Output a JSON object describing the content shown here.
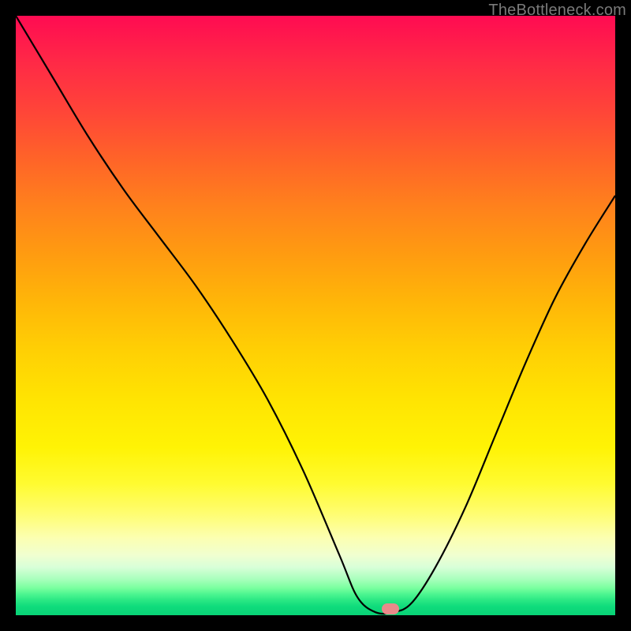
{
  "watermark": "TheBottleneck.com",
  "marker": {
    "color": "#e98a8a",
    "x_pct": 62.5,
    "y_pct": 99.0
  },
  "chart_data": {
    "type": "line",
    "title": "",
    "xlabel": "",
    "ylabel": "",
    "xlim": [
      0,
      100
    ],
    "ylim": [
      0,
      100
    ],
    "grid": false,
    "legend": false,
    "series": [
      {
        "name": "bottleneck-curve",
        "x": [
          0,
          6,
          12,
          18,
          24,
          30,
          36,
          42,
          48,
          54,
          57,
          60,
          63,
          66,
          70,
          75,
          80,
          85,
          90,
          95,
          100
        ],
        "y": [
          100,
          90,
          80,
          71,
          63,
          55,
          46,
          36,
          24,
          10,
          3,
          0.5,
          0.5,
          2,
          8,
          18,
          30,
          42,
          53,
          62,
          70
        ]
      }
    ],
    "annotations": [
      {
        "type": "marker",
        "x": 62.5,
        "y": 1.0,
        "color": "#e98a8a",
        "shape": "pill"
      }
    ],
    "background_gradient": {
      "direction": "vertical",
      "stops": [
        {
          "pos": 0.0,
          "color": "#ff0b52"
        },
        {
          "pos": 0.25,
          "color": "#ff6a24"
        },
        {
          "pos": 0.5,
          "color": "#ffc206"
        },
        {
          "pos": 0.75,
          "color": "#fff520"
        },
        {
          "pos": 0.9,
          "color": "#f4ffc8"
        },
        {
          "pos": 1.0,
          "color": "#08d276"
        }
      ]
    }
  }
}
